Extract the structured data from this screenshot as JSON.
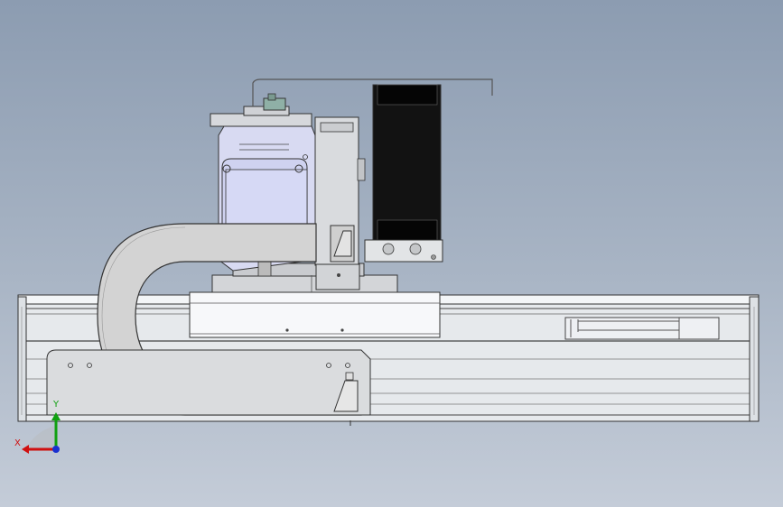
{
  "viewport": {
    "background_top": "#8c9cb1",
    "background_bottom": "#c4ccd8"
  },
  "model": {
    "description_colors": {
      "rail": "#e9ecef",
      "steel": "#d2d4d6",
      "motor_housing": "#d4d6f0",
      "fan_black": "#111111",
      "cable_chain": "#d4d4d4"
    }
  },
  "triad": {
    "x_label": "X",
    "y_label": "Y",
    "x_color": "#d01010",
    "y_color": "#10a010",
    "z_color": "#1a30d0"
  }
}
